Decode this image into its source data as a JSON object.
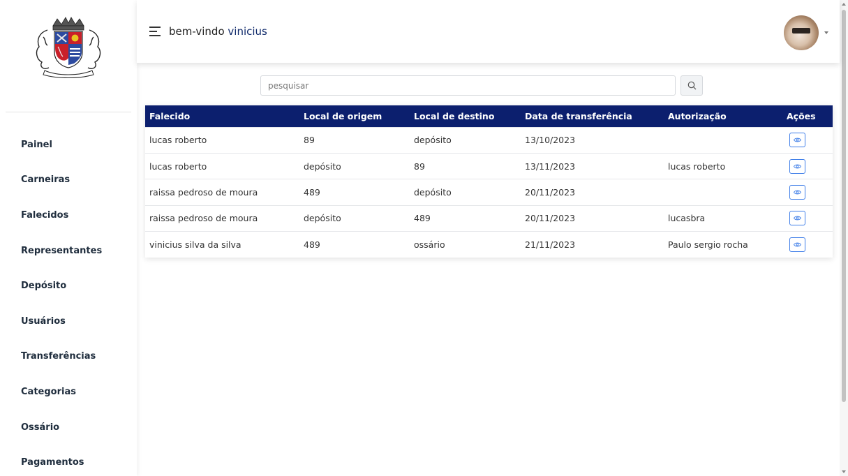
{
  "header": {
    "greeting": "bem-vindo",
    "username": "vinicius"
  },
  "sidebar": {
    "items": [
      {
        "label": "Painel"
      },
      {
        "label": "Carneiras"
      },
      {
        "label": "Falecidos"
      },
      {
        "label": "Representantes"
      },
      {
        "label": "Depósito"
      },
      {
        "label": "Usuários"
      },
      {
        "label": "Transferências"
      },
      {
        "label": "Categorias"
      },
      {
        "label": "Ossário"
      },
      {
        "label": "Pagamentos"
      }
    ]
  },
  "search": {
    "placeholder": "pesquisar",
    "icon": "search-icon"
  },
  "table": {
    "columns": [
      "Falecido",
      "Local de origem",
      "Local de destino",
      "Data de transferência",
      "Autorização",
      "Ações"
    ],
    "rows": [
      [
        "lucas roberto",
        "89",
        "depósito",
        "13/10/2023",
        ""
      ],
      [
        "lucas roberto",
        "depósito",
        "89",
        "13/11/2023",
        "lucas roberto"
      ],
      [
        "raissa pedroso de moura",
        "489",
        "depósito",
        "20/11/2023",
        ""
      ],
      [
        "raissa pedroso de moura",
        "depósito",
        "489",
        "20/11/2023",
        "lucasbra"
      ],
      [
        "vinicius silva da silva",
        "489",
        "ossário",
        "21/11/2023",
        "Paulo sergio rocha"
      ]
    ],
    "action_icon": "eye-icon"
  },
  "colors": {
    "header_bg": "#0c1f6e",
    "username": "#102a6b",
    "action_border": "#3d7de8"
  }
}
